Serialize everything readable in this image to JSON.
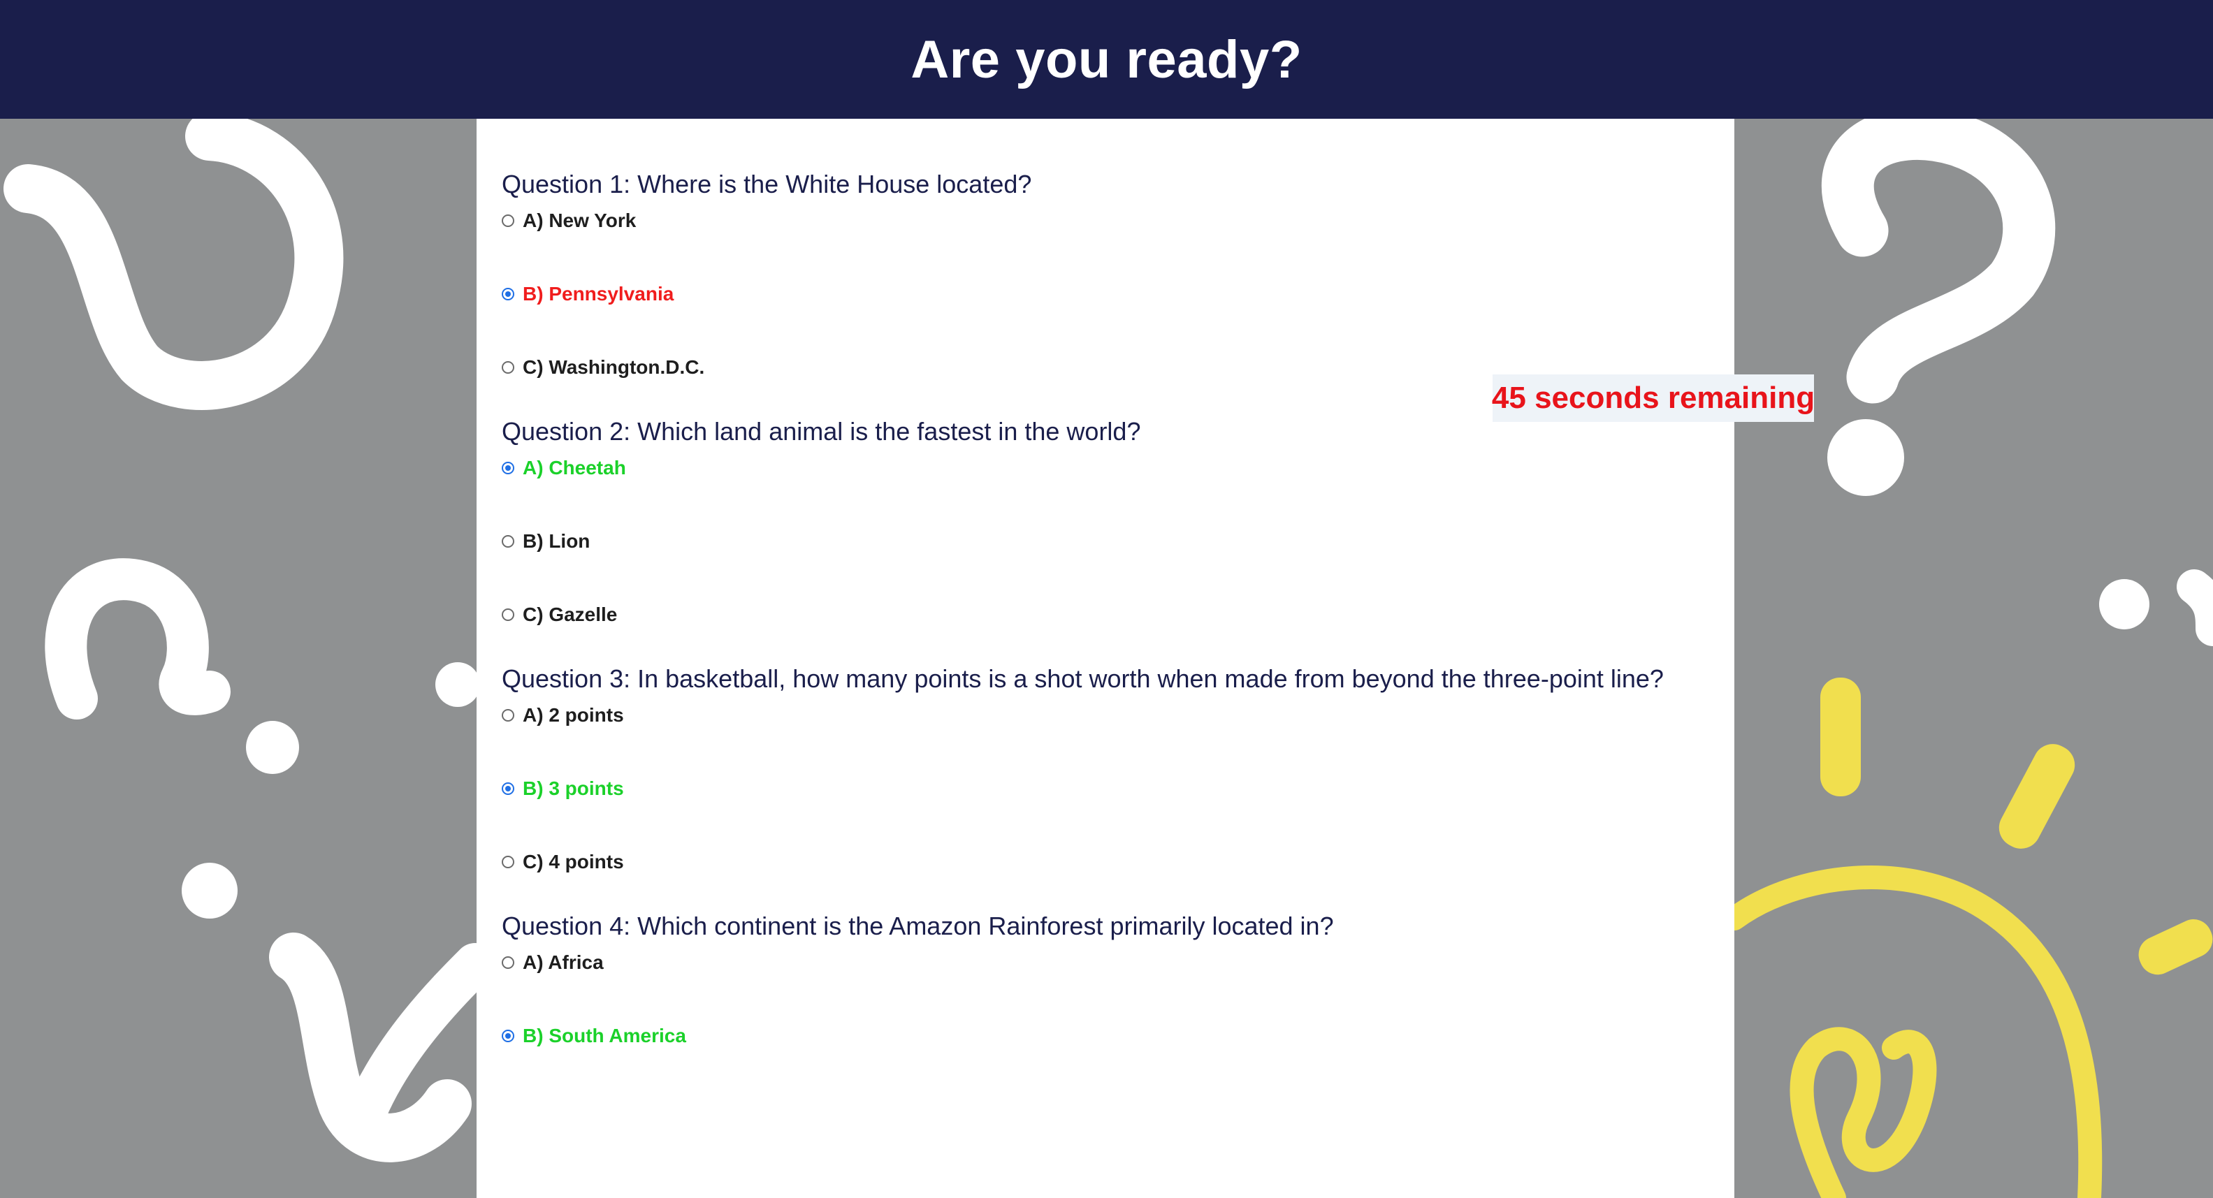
{
  "header": {
    "title": "Are you ready?"
  },
  "timer": {
    "text": "45 seconds remaining"
  },
  "questions": [
    {
      "text": "Question 1: Where is the White House located?",
      "options": [
        {
          "label": "A) New York",
          "selected": false,
          "state": "neutral"
        },
        {
          "label": "B) Pennsylvania",
          "selected": true,
          "state": "wrong"
        },
        {
          "label": "C) Washington.D.C.",
          "selected": false,
          "state": "neutral"
        }
      ]
    },
    {
      "text": "Question 2: Which land animal is the fastest in the world?",
      "options": [
        {
          "label": "A) Cheetah",
          "selected": true,
          "state": "right"
        },
        {
          "label": "B) Lion",
          "selected": false,
          "state": "neutral"
        },
        {
          "label": "C) Gazelle",
          "selected": false,
          "state": "neutral"
        }
      ]
    },
    {
      "text": "Question 3: In basketball, how many points is a shot worth when made from beyond the three-point line?",
      "options": [
        {
          "label": "A) 2 points",
          "selected": false,
          "state": "neutral"
        },
        {
          "label": "B) 3 points",
          "selected": true,
          "state": "right"
        },
        {
          "label": "C) 4 points",
          "selected": false,
          "state": "neutral"
        }
      ]
    },
    {
      "text": "Question 4: Which continent is the Amazon Rainforest primarily located in?",
      "options": [
        {
          "label": "A) Africa",
          "selected": false,
          "state": "neutral"
        },
        {
          "label": "B) South America",
          "selected": true,
          "state": "right"
        }
      ]
    }
  ],
  "colors": {
    "header_bg": "#1a1e4b",
    "page_bg": "#8f9192",
    "wrong": "#f01d1d",
    "right": "#1bd12a",
    "timer_text": "#e8141b",
    "accent_yellow": "#f1df4e"
  }
}
